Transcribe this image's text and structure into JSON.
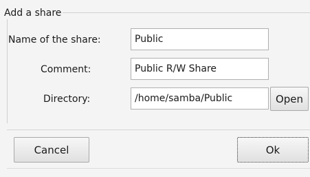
{
  "dialog": {
    "group_title": "Add a share",
    "fields": {
      "name": {
        "label": "Name of the share:",
        "value": "Public"
      },
      "comment": {
        "label": "Comment:",
        "value": "Public R/W Share"
      },
      "directory": {
        "label": "Directory:",
        "value": "/home/samba/Public"
      }
    },
    "buttons": {
      "open": "Open",
      "cancel": "Cancel",
      "ok": "Ok"
    }
  }
}
